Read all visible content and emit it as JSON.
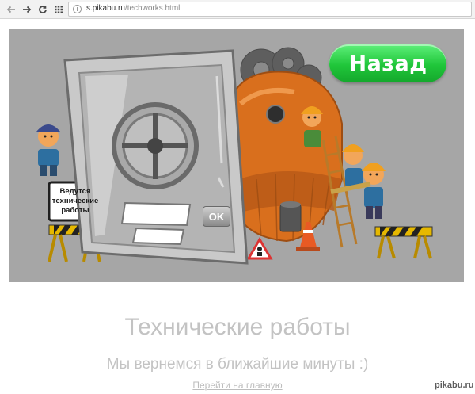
{
  "browser": {
    "url_host": "s.pikabu.ru",
    "url_path": "/techworks.html",
    "icons": [
      "back-arrow-icon",
      "forward-arrow-icon",
      "reload-icon",
      "apps-grid-icon",
      "page-info-icon"
    ]
  },
  "banner": {
    "back_button_label": "Назад",
    "sign_text": "Ведутся технические работы",
    "ok_button_label": "OK",
    "colors": {
      "background": "#a6a6a6",
      "back_button": "#22c93c",
      "dome": "#e07a26"
    }
  },
  "page": {
    "title": "Технические работы",
    "subtitle": "Мы вернемся в ближайшие минуты :)",
    "home_link": "Перейти на главную"
  },
  "watermark": "pikabu.ru"
}
